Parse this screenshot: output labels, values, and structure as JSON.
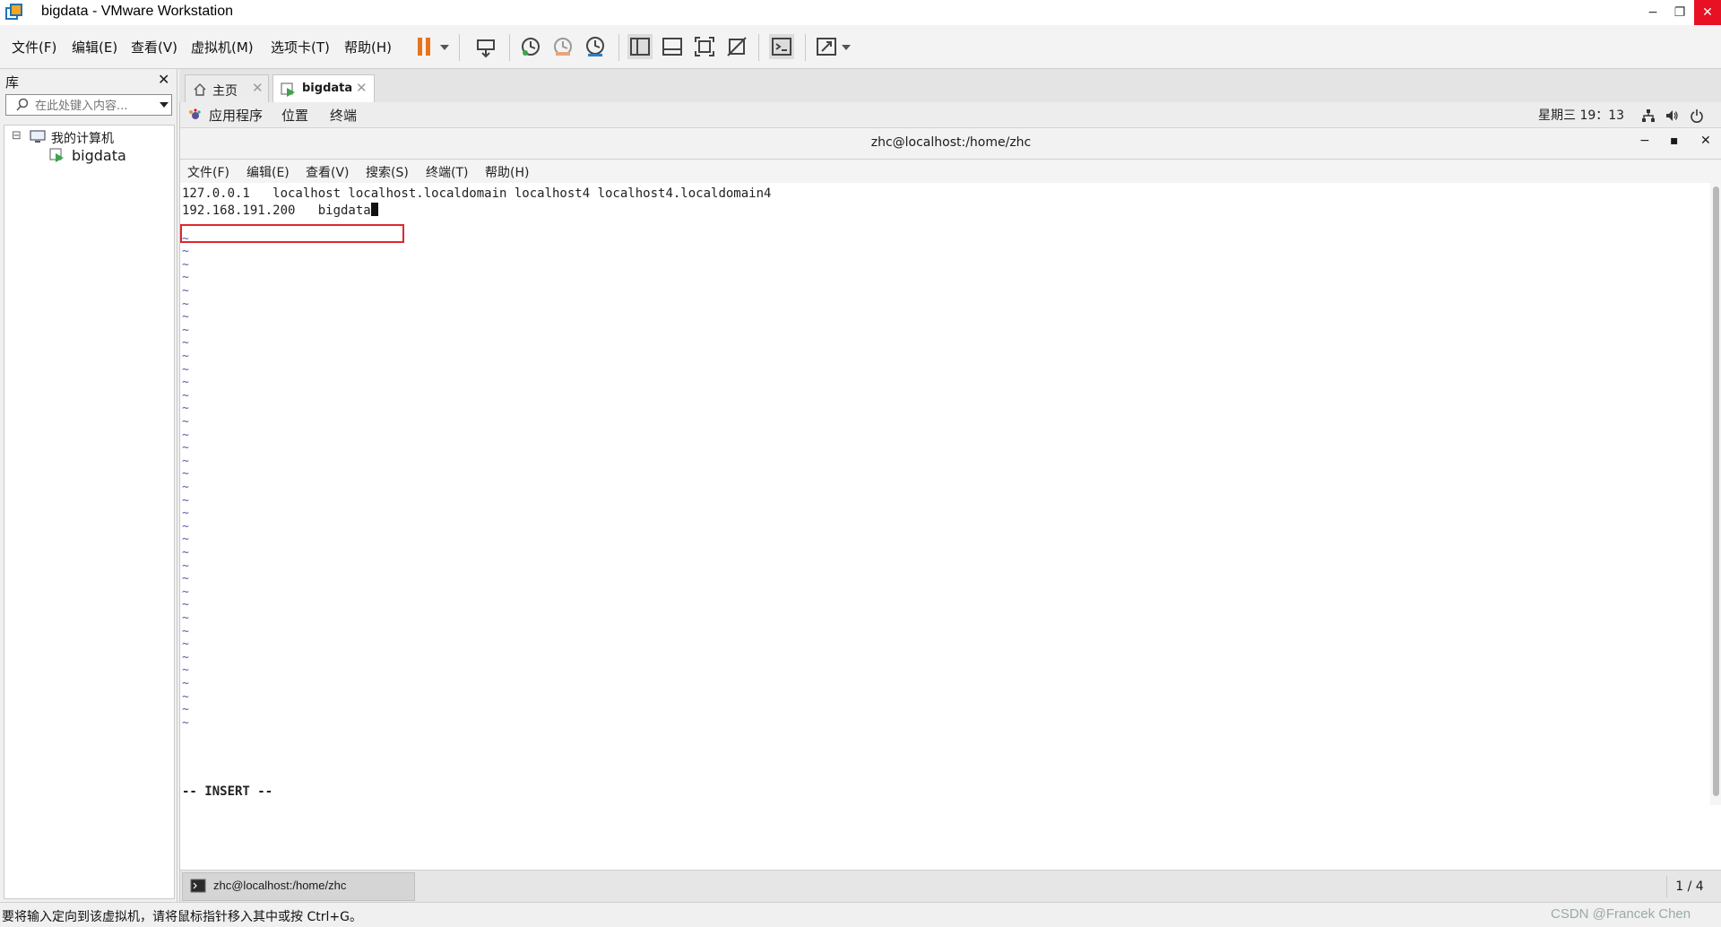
{
  "window": {
    "title": "bigdata - VMware Workstation",
    "minimize": "−",
    "restore": "❐",
    "close": "✕"
  },
  "menubar": {
    "items": [
      "文件(F)",
      "编辑(E)",
      "查看(V)",
      "虚拟机(M)",
      "选项卡(T)",
      "帮助(H)"
    ]
  },
  "library": {
    "title": "库",
    "close": "✕",
    "search_placeholder": "在此处键入内容...",
    "tree": {
      "root_label": "我的计算机",
      "expand_symbol": "⊟",
      "children": [
        "bigdata"
      ]
    }
  },
  "tabs": [
    {
      "label": "主页",
      "close": "✕",
      "active": false
    },
    {
      "label": "bigdata",
      "close": "✕",
      "active": true
    }
  ],
  "gnome_bar": {
    "apps": "应用程序",
    "places": "位置",
    "terminal": "终端",
    "clock": "星期三 19：13"
  },
  "terminal": {
    "title": "zhc@localhost:/home/zhc",
    "minimize": "−",
    "maximize": "▪",
    "close": "✕",
    "menu": [
      "文件(F)",
      "编辑(E)",
      "查看(V)",
      "搜索(S)",
      "终端(T)",
      "帮助(H)"
    ],
    "lines": [
      "127.0.0.1   localhost localhost.localdomain localhost4 localhost4.localdomain4",
      "192.168.191.200   bigdata"
    ],
    "tilde": "~",
    "mode": "-- INSERT --"
  },
  "taskbar": {
    "task": "zhc@localhost:/home/zhc",
    "pages": "1 / 4"
  },
  "statusbar": {
    "message": "要将输入定向到该虚拟机，请将鼠标指针移入其中或按 Ctrl+G。",
    "watermark": "CSDN @Francek Chen"
  },
  "colors": {
    "accent_orange": "#e8741a",
    "close_red": "#e81123",
    "highlight_red": "#e0262e"
  }
}
